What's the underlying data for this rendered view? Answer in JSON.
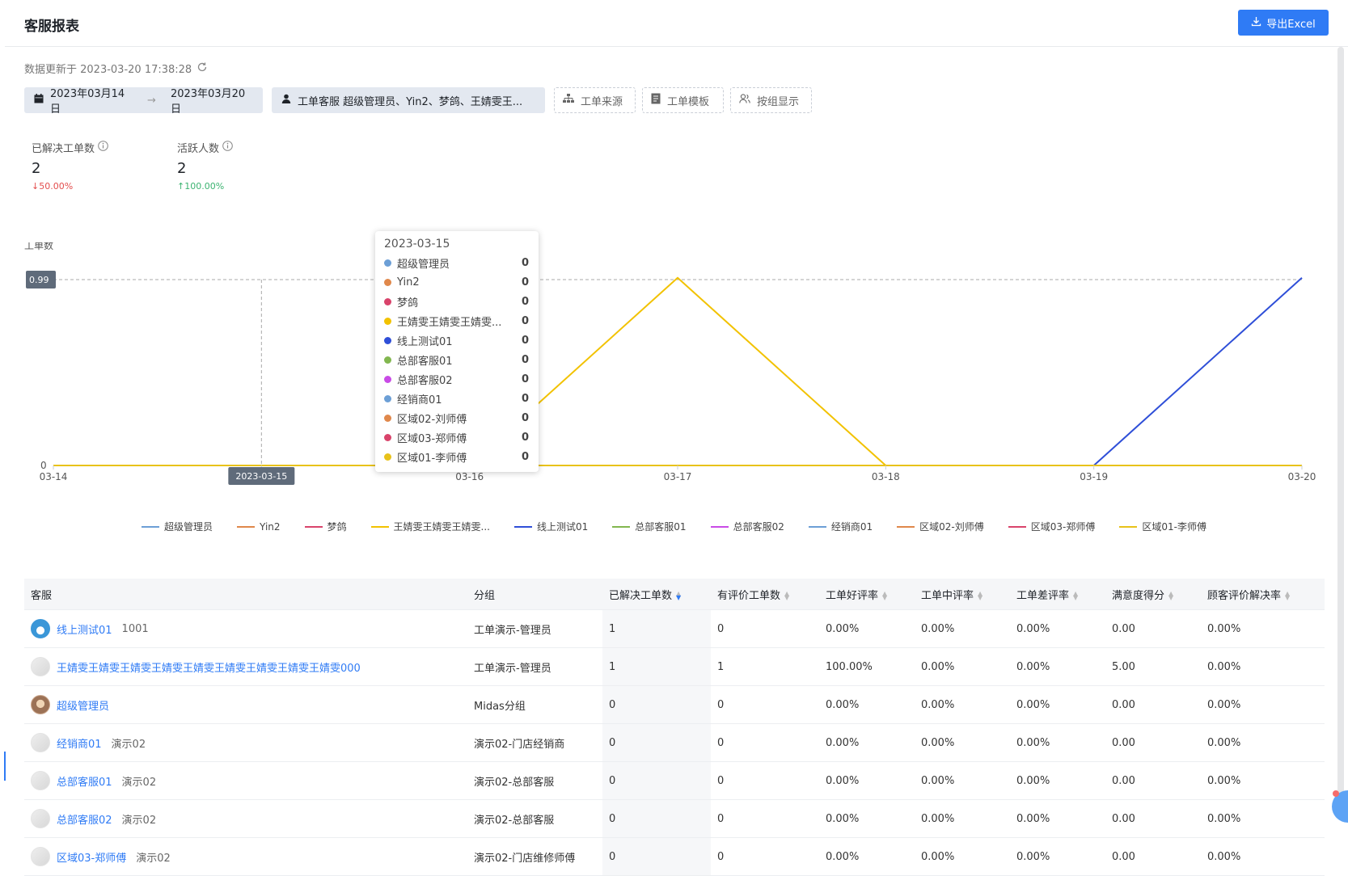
{
  "header": {
    "title": "客服报表",
    "export_label": "导出Excel"
  },
  "updated": {
    "text": "数据更新于 2023-03-20 17:38:28"
  },
  "filters": {
    "date_start": "2023年03月14日",
    "date_sep": "→",
    "date_end": "2023年03月20日",
    "agent_filter": "工单客服 超级管理员、Yin2、梦鸽、王婧雯王...",
    "source": "工单来源",
    "template": "工单模板",
    "group_display": "按组显示"
  },
  "kpis": [
    {
      "label": "已解决工单数",
      "value": "2",
      "delta": "↓50.00%",
      "trend": "down",
      "color": "#e34d4d"
    },
    {
      "label": "活跃人数",
      "value": "2",
      "delta": "↑100.00%",
      "trend": "up",
      "color": "#3cb371"
    }
  ],
  "chart_data": {
    "type": "line",
    "ylabel": "工单数",
    "ylim": [
      0,
      0.99
    ],
    "y_ticks": [
      "0"
    ],
    "x": [
      "03-14",
      "03-15",
      "03-16",
      "03-17",
      "03-18",
      "03-19",
      "03-20"
    ],
    "crosshair": {
      "x_label": "2023-03-15",
      "y_label": "0.99"
    },
    "series": [
      {
        "name": "超级管理员",
        "color": "#6c9fd6",
        "values": [
          0,
          0,
          0,
          0,
          0,
          0,
          0
        ]
      },
      {
        "name": "Yin2",
        "color": "#e0884b",
        "values": [
          0,
          0,
          0,
          0,
          0,
          0,
          0
        ]
      },
      {
        "name": "梦鸽",
        "color": "#d9436b",
        "values": [
          0,
          0,
          0,
          0,
          0,
          0,
          0
        ]
      },
      {
        "name": "王婧雯王婧雯王婧雯...",
        "color": "#f2c200",
        "values": [
          0,
          0,
          0,
          1,
          0,
          0,
          0
        ]
      },
      {
        "name": "线上测试01",
        "color": "#2f4fd8",
        "values": [
          0,
          0,
          0,
          0,
          0,
          0,
          1
        ]
      },
      {
        "name": "总部客服01",
        "color": "#82b74f",
        "values": [
          0,
          0,
          0,
          0,
          0,
          0,
          0
        ]
      },
      {
        "name": "总部客服02",
        "color": "#c94be6",
        "values": [
          0,
          0,
          0,
          0,
          0,
          0,
          0
        ]
      },
      {
        "name": "经销商01",
        "color": "#6c9fd6",
        "values": [
          0,
          0,
          0,
          0,
          0,
          0,
          0
        ]
      },
      {
        "name": "区域02-刘师傅",
        "color": "#e0884b",
        "values": [
          0,
          0,
          0,
          0,
          0,
          0,
          0
        ]
      },
      {
        "name": "区域03-郑师傅",
        "color": "#d9436b",
        "values": [
          0,
          0,
          0,
          0,
          0,
          0,
          0
        ]
      },
      {
        "name": "区域01-李师傅",
        "color": "#e8c21a",
        "values": [
          0,
          0,
          0,
          0,
          0,
          0,
          0
        ]
      }
    ]
  },
  "tooltip": {
    "date": "2023-03-15",
    "rows": [
      {
        "name": "超级管理员",
        "value": "0",
        "color": "#6c9fd6"
      },
      {
        "name": "Yin2",
        "value": "0",
        "color": "#e0884b"
      },
      {
        "name": "梦鸽",
        "value": "0",
        "color": "#d9436b"
      },
      {
        "name": "王婧雯王婧雯王婧雯...",
        "value": "0",
        "color": "#f2c200"
      },
      {
        "name": "线上测试01",
        "value": "0",
        "color": "#2f4fd8"
      },
      {
        "name": "总部客服01",
        "value": "0",
        "color": "#82b74f"
      },
      {
        "name": "总部客服02",
        "value": "0",
        "color": "#c94be6"
      },
      {
        "name": "经销商01",
        "value": "0",
        "color": "#6c9fd6"
      },
      {
        "name": "区域02-刘师傅",
        "value": "0",
        "color": "#e0884b"
      },
      {
        "name": "区域03-郑师傅",
        "value": "0",
        "color": "#d9436b"
      },
      {
        "name": "区域01-李师傅",
        "value": "0",
        "color": "#e8c21a"
      }
    ]
  },
  "table": {
    "columns": [
      "客服",
      "分组",
      "已解决工单数",
      "有评价工单数",
      "工单好评率",
      "工单中评率",
      "工单差评率",
      "满意度得分",
      "顾客评价解决率"
    ],
    "rows": [
      {
        "name": "线上测试01",
        "sub": "1001",
        "avatar": "blue",
        "cells": [
          "工单演示-管理员",
          "1",
          "0",
          "0.00%",
          "0.00%",
          "0.00%",
          "0.00",
          "0.00%"
        ]
      },
      {
        "name": "王婧雯王婧雯王婧雯王婧雯王婧雯王婧雯王婧雯王婧雯王婧雯000",
        "sub": "",
        "avatar": "gray",
        "cells": [
          "工单演示-管理员",
          "1",
          "1",
          "100.00%",
          "0.00%",
          "0.00%",
          "5.00",
          "0.00%"
        ]
      },
      {
        "name": "超级管理员",
        "sub": "",
        "avatar": "brown",
        "cells": [
          "Midas分组",
          "0",
          "0",
          "0.00%",
          "0.00%",
          "0.00%",
          "0.00",
          "0.00%"
        ]
      },
      {
        "name": "经销商01",
        "sub": "演示02",
        "avatar": "gray",
        "cells": [
          "演示02-门店经销商",
          "0",
          "0",
          "0.00%",
          "0.00%",
          "0.00%",
          "0.00",
          "0.00%"
        ]
      },
      {
        "name": "总部客服01",
        "sub": "演示02",
        "avatar": "gray",
        "cells": [
          "演示02-总部客服",
          "0",
          "0",
          "0.00%",
          "0.00%",
          "0.00%",
          "0.00",
          "0.00%"
        ]
      },
      {
        "name": "总部客服02",
        "sub": "演示02",
        "avatar": "gray",
        "cells": [
          "演示02-总部客服",
          "0",
          "0",
          "0.00%",
          "0.00%",
          "0.00%",
          "0.00",
          "0.00%"
        ]
      },
      {
        "name": "区域03-郑师傅",
        "sub": "演示02",
        "avatar": "gray",
        "cells": [
          "演示02-门店维修师傅",
          "0",
          "0",
          "0.00%",
          "0.00%",
          "0.00%",
          "0.00",
          "0.00%"
        ]
      }
    ]
  }
}
